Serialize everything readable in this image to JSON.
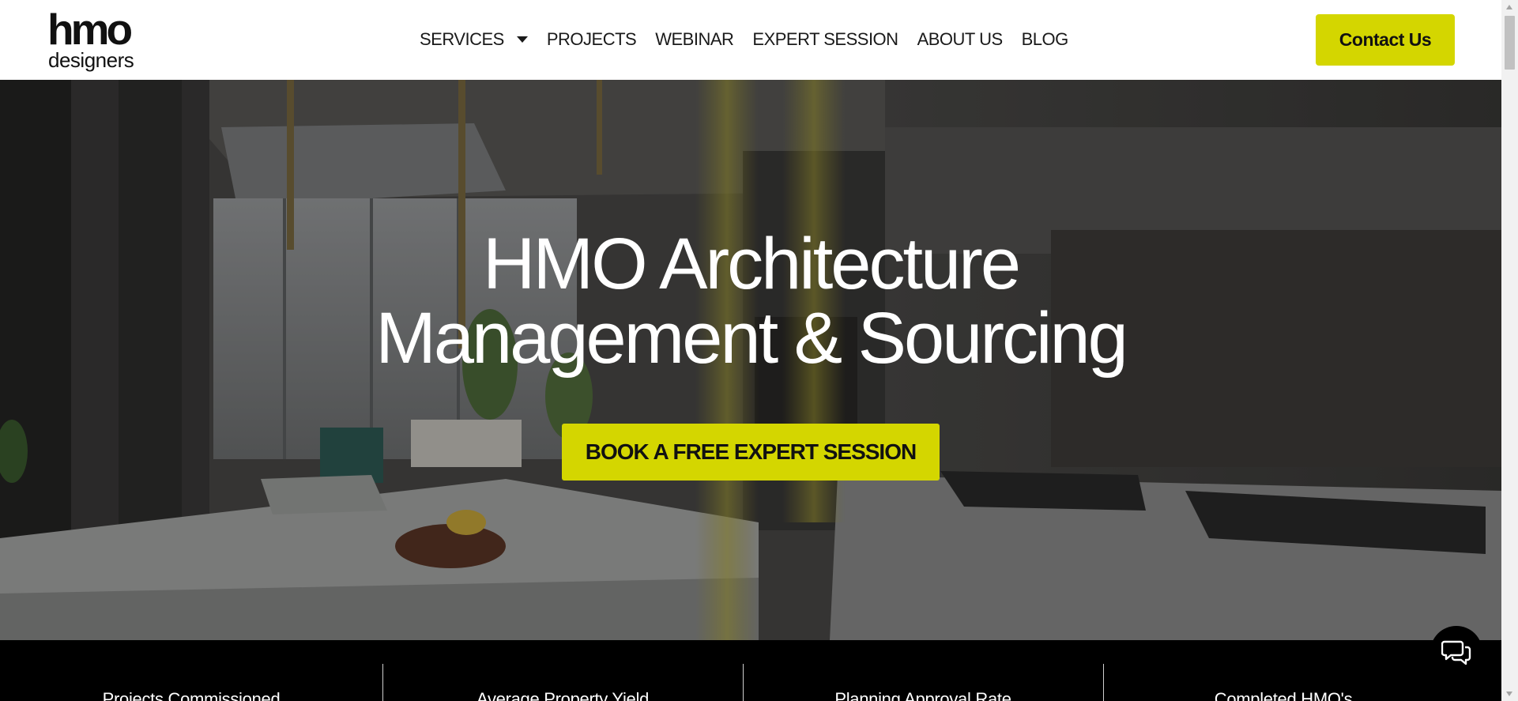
{
  "logo": {
    "line1": "hmo",
    "line2": "designers"
  },
  "nav": {
    "items": [
      {
        "label": "SERVICES",
        "has_dropdown": true,
        "icon": "chevron-down-icon"
      },
      {
        "label": "PROJECTS"
      },
      {
        "label": "WEBINAR"
      },
      {
        "label": "EXPERT SESSION"
      },
      {
        "label": "ABOUT US"
      },
      {
        "label": "BLOG"
      }
    ]
  },
  "header": {
    "contact_label": "Contact Us"
  },
  "hero": {
    "title_line1": "HMO Architecture",
    "title_line2": "Management & Sourcing",
    "cta_label": "BOOK A FREE EXPERT SESSION"
  },
  "stats": {
    "items": [
      {
        "label": "Projects Commissioned"
      },
      {
        "label": "Average Property Yield"
      },
      {
        "label": "Planning Approval Rate"
      },
      {
        "label": "Completed HMO's"
      }
    ]
  },
  "chat": {
    "icon": "chat-bubbles-icon"
  },
  "colors": {
    "accent": "#d4d600",
    "header_bg": "#ffffff",
    "stats_bg": "#000000",
    "hero_text": "#ffffff"
  }
}
